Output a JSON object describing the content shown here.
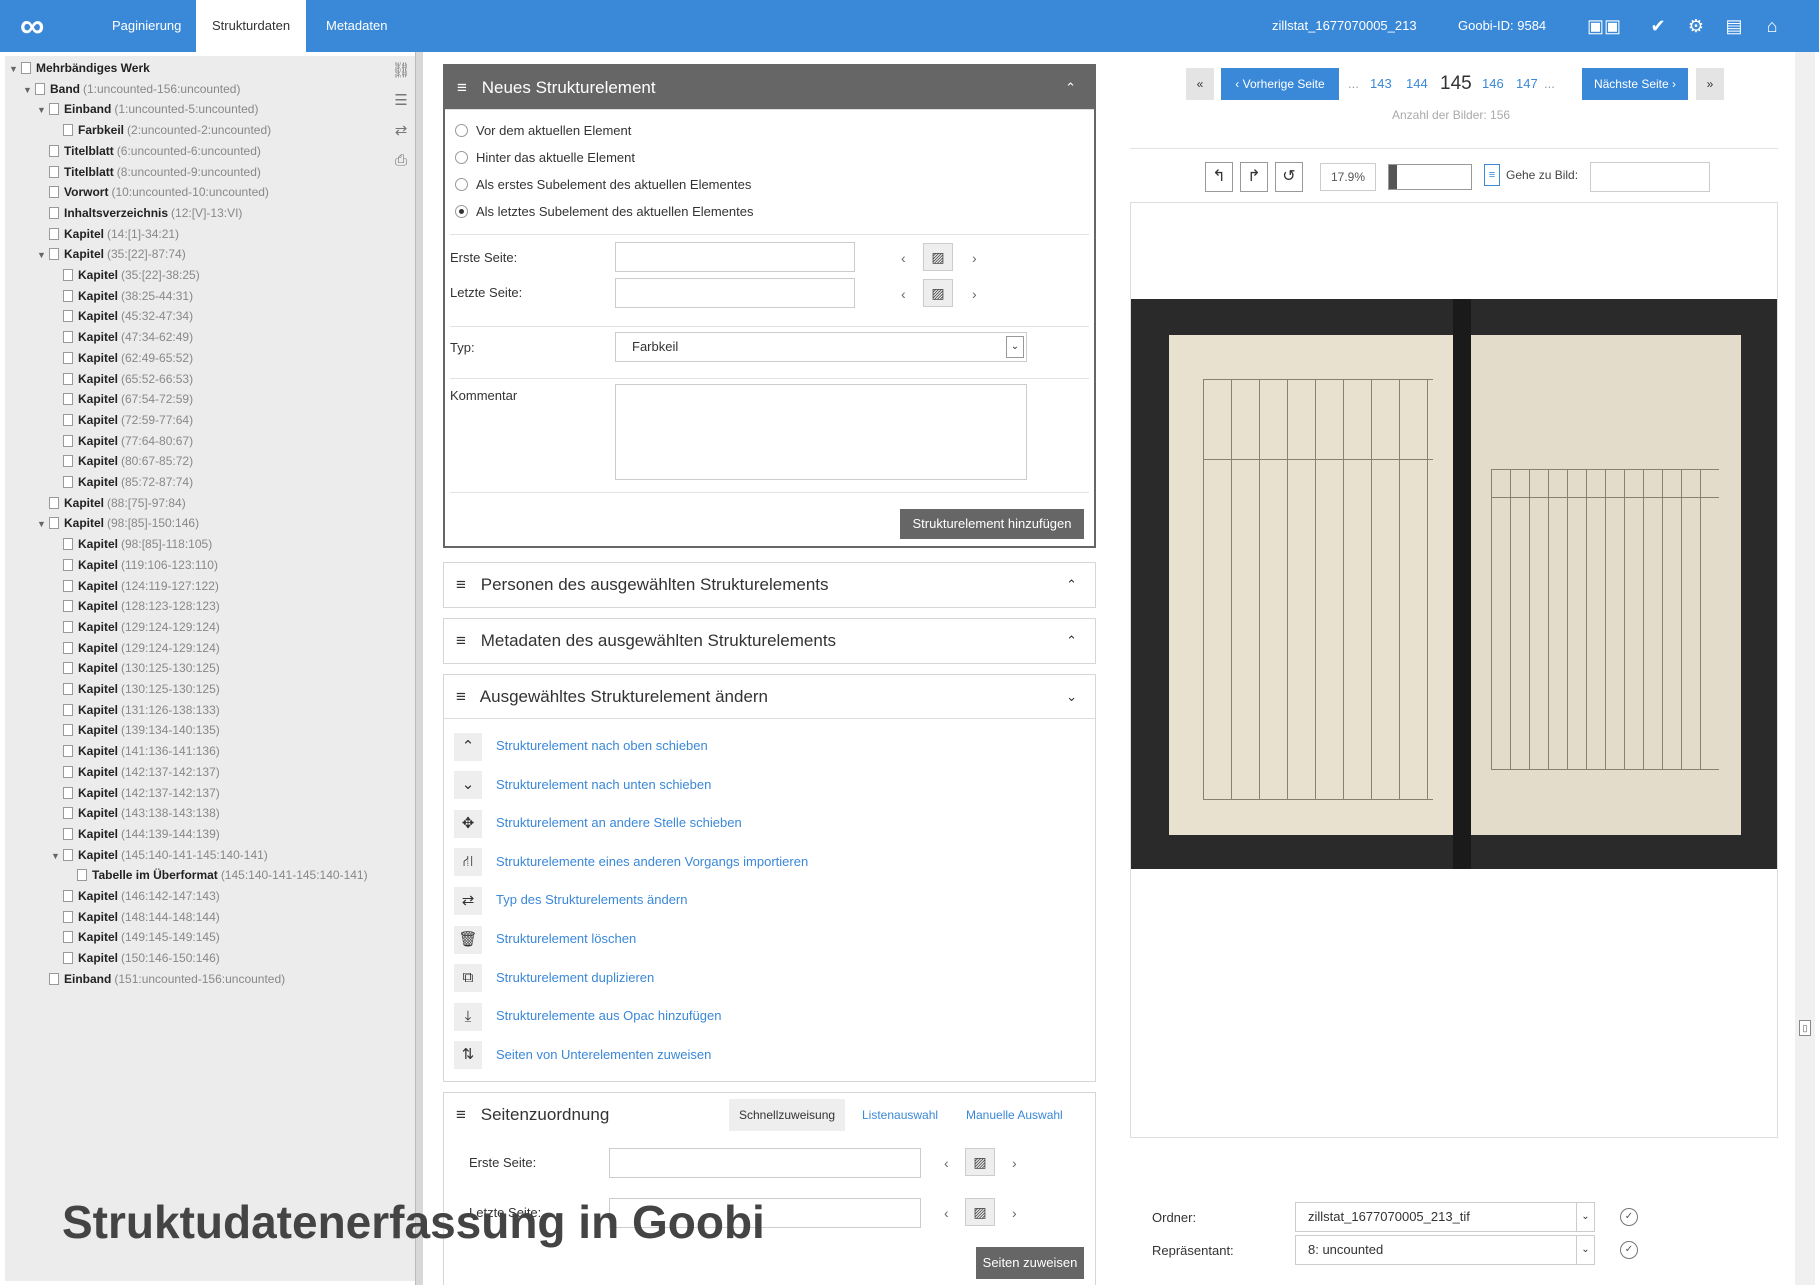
{
  "colors": {
    "accent": "#3a88d8",
    "panel_dark": "#666666",
    "tree_bg": "#ececec"
  },
  "topbar": {
    "logo_icon": "goobi-infinity-logo",
    "tabs": [
      "Paginierung",
      "Strukturdaten",
      "Metadaten"
    ],
    "active_tab": "Strukturdaten",
    "process_name": "zillstat_1677070005_213",
    "goobi_id": "Goobi-ID: 9584",
    "icons": [
      "images-icon",
      "check-icon",
      "gear-icon",
      "save-icon",
      "home-icon"
    ]
  },
  "tree": {
    "icons": [
      "unlink-icon",
      "list-icon",
      "swap-icon",
      "print-icon"
    ],
    "nodes": [
      {
        "indent": 0,
        "toggle": "▼",
        "label": "Mehrbändiges Werk",
        "pages": ""
      },
      {
        "indent": 1,
        "toggle": "▼",
        "label": "Band",
        "pages": "(1:uncounted-156:uncounted)"
      },
      {
        "indent": 2,
        "toggle": "▼",
        "label": "Einband",
        "pages": "(1:uncounted-5:uncounted)"
      },
      {
        "indent": 3,
        "toggle": "",
        "label": "Farbkeil",
        "pages": "(2:uncounted-2:uncounted)"
      },
      {
        "indent": 2,
        "toggle": "",
        "label": "Titelblatt",
        "pages": "(6:uncounted-6:uncounted)"
      },
      {
        "indent": 2,
        "toggle": "",
        "label": "Titelblatt",
        "pages": "(8:uncounted-9:uncounted)"
      },
      {
        "indent": 2,
        "toggle": "",
        "label": "Vorwort",
        "pages": "(10:uncounted-10:uncounted)"
      },
      {
        "indent": 2,
        "toggle": "",
        "label": "Inhaltsverzeichnis",
        "pages": "(12:[V]-13:VI)"
      },
      {
        "indent": 2,
        "toggle": "",
        "label": "Kapitel",
        "pages": "(14:[1]-34:21)"
      },
      {
        "indent": 2,
        "toggle": "▼",
        "label": "Kapitel",
        "pages": "(35:[22]-87:74)"
      },
      {
        "indent": 3,
        "toggle": "",
        "label": "Kapitel",
        "pages": "(35:[22]-38:25)"
      },
      {
        "indent": 3,
        "toggle": "",
        "label": "Kapitel",
        "pages": "(38:25-44:31)"
      },
      {
        "indent": 3,
        "toggle": "",
        "label": "Kapitel",
        "pages": "(45:32-47:34)"
      },
      {
        "indent": 3,
        "toggle": "",
        "label": "Kapitel",
        "pages": "(47:34-62:49)"
      },
      {
        "indent": 3,
        "toggle": "",
        "label": "Kapitel",
        "pages": "(62:49-65:52)"
      },
      {
        "indent": 3,
        "toggle": "",
        "label": "Kapitel",
        "pages": "(65:52-66:53)"
      },
      {
        "indent": 3,
        "toggle": "",
        "label": "Kapitel",
        "pages": "(67:54-72:59)"
      },
      {
        "indent": 3,
        "toggle": "",
        "label": "Kapitel",
        "pages": "(72:59-77:64)"
      },
      {
        "indent": 3,
        "toggle": "",
        "label": "Kapitel",
        "pages": "(77:64-80:67)"
      },
      {
        "indent": 3,
        "toggle": "",
        "label": "Kapitel",
        "pages": "(80:67-85:72)"
      },
      {
        "indent": 3,
        "toggle": "",
        "label": "Kapitel",
        "pages": "(85:72-87:74)"
      },
      {
        "indent": 2,
        "toggle": "",
        "label": "Kapitel",
        "pages": "(88:[75]-97:84)"
      },
      {
        "indent": 2,
        "toggle": "▼",
        "label": "Kapitel",
        "pages": "(98:[85]-150:146)"
      },
      {
        "indent": 3,
        "toggle": "",
        "label": "Kapitel",
        "pages": "(98:[85]-118:105)"
      },
      {
        "indent": 3,
        "toggle": "",
        "label": "Kapitel",
        "pages": "(119:106-123:110)"
      },
      {
        "indent": 3,
        "toggle": "",
        "label": "Kapitel",
        "pages": "(124:119-127:122)"
      },
      {
        "indent": 3,
        "toggle": "",
        "label": "Kapitel",
        "pages": "(128:123-128:123)"
      },
      {
        "indent": 3,
        "toggle": "",
        "label": "Kapitel",
        "pages": "(129:124-129:124)"
      },
      {
        "indent": 3,
        "toggle": "",
        "label": "Kapitel",
        "pages": "(129:124-129:124)"
      },
      {
        "indent": 3,
        "toggle": "",
        "label": "Kapitel",
        "pages": "(130:125-130:125)"
      },
      {
        "indent": 3,
        "toggle": "",
        "label": "Kapitel",
        "pages": "(130:125-130:125)"
      },
      {
        "indent": 3,
        "toggle": "",
        "label": "Kapitel",
        "pages": "(131:126-138:133)"
      },
      {
        "indent": 3,
        "toggle": "",
        "label": "Kapitel",
        "pages": "(139:134-140:135)"
      },
      {
        "indent": 3,
        "toggle": "",
        "label": "Kapitel",
        "pages": "(141:136-141:136)"
      },
      {
        "indent": 3,
        "toggle": "",
        "label": "Kapitel",
        "pages": "(142:137-142:137)"
      },
      {
        "indent": 3,
        "toggle": "",
        "label": "Kapitel",
        "pages": "(142:137-142:137)"
      },
      {
        "indent": 3,
        "toggle": "",
        "label": "Kapitel",
        "pages": "(143:138-143:138)"
      },
      {
        "indent": 3,
        "toggle": "",
        "label": "Kapitel",
        "pages": "(144:139-144:139)"
      },
      {
        "indent": 3,
        "toggle": "▼",
        "label": "Kapitel",
        "pages": "(145:140-141-145:140-141)"
      },
      {
        "indent": 4,
        "toggle": "",
        "label": "Tabelle im Überformat",
        "pages": "(145:140-141-145:140-141)"
      },
      {
        "indent": 3,
        "toggle": "",
        "label": "Kapitel",
        "pages": "(146:142-147:143)"
      },
      {
        "indent": 3,
        "toggle": "",
        "label": "Kapitel",
        "pages": "(148:144-148:144)"
      },
      {
        "indent": 3,
        "toggle": "",
        "label": "Kapitel",
        "pages": "(149:145-149:145)"
      },
      {
        "indent": 3,
        "toggle": "",
        "label": "Kapitel",
        "pages": "(150:146-150:146)"
      },
      {
        "indent": 2,
        "toggle": "",
        "label": "Einband",
        "pages": "(151:uncounted-156:uncounted)"
      }
    ]
  },
  "new_element": {
    "title": "Neues Strukturelement",
    "options": [
      "Vor dem aktuellen Element",
      "Hinter das aktuelle Element",
      "Als erstes Subelement des aktuellen Elementes",
      "Als letztes Subelement des aktuellen Elementes"
    ],
    "selected_option": 3,
    "first_page_label": "Erste Seite:",
    "last_page_label": "Letzte Seite:",
    "type_label": "Typ:",
    "type_value": "Farbkeil",
    "comment_label": "Kommentar",
    "add_button": "Strukturelement hinzufügen"
  },
  "persons_panel": {
    "title": "Personen des ausgewählten Strukturelements"
  },
  "metadata_panel": {
    "title": "Metadaten des ausgewählten Strukturelements"
  },
  "change_panel": {
    "title": "Ausgewähltes Strukturelement ändern",
    "actions": [
      {
        "icon": "chevron-up-icon",
        "glyph": "⌃",
        "label": "Strukturelement nach oben schieben"
      },
      {
        "icon": "chevron-down-icon",
        "glyph": "⌄",
        "label": "Strukturelement nach unten schieben"
      },
      {
        "icon": "move-icon",
        "glyph": "✥",
        "label": "Strukturelement an andere Stelle schieben"
      },
      {
        "icon": "import-icon",
        "glyph": "⛙",
        "label": "Strukturelemente eines anderen Vorgangs importieren"
      },
      {
        "icon": "swap-icon",
        "glyph": "⇄",
        "label": "Typ des Strukturelements ändern"
      },
      {
        "icon": "trash-icon",
        "glyph": "🗑",
        "label": "Strukturelement löschen"
      },
      {
        "icon": "duplicate-icon",
        "glyph": "⧉",
        "label": "Strukturelement duplizieren"
      },
      {
        "icon": "download-icon",
        "glyph": "⤓",
        "label": "Strukturelemente aus Opac hinzufügen"
      },
      {
        "icon": "sort-icon",
        "glyph": "⇅",
        "label": "Seiten von Unterelementen zuweisen"
      }
    ]
  },
  "assign_panel": {
    "title": "Seitenzuordnung",
    "tabs": [
      "Schnellzuweisung",
      "Listenauswahl",
      "Manuelle Auswahl"
    ],
    "first_page_label": "Erste Seite:",
    "last_page_label": "Letzte Seite:",
    "assign_button": "Seiten zuweisen"
  },
  "viewer": {
    "first_btn": "«",
    "prev_btn": "‹ Vorherige Seite",
    "pages": [
      "...",
      "143",
      "144",
      "145",
      "146",
      "147",
      "..."
    ],
    "current_page": "145",
    "next_btn": "Nächste Seite ›",
    "last_btn": "»",
    "image_count": "Anzahl der Bilder: 156",
    "zoom": "17.9%",
    "zoom_level": 0.02,
    "goto_label": "Gehe zu Bild:",
    "folder_label": "Ordner:",
    "folder_value": "zillstat_1677070005_213_tif",
    "rep_label": "Repräsentant:",
    "rep_value": "8: uncounted"
  },
  "caption": "Struktudatenerfassung in Goobi"
}
